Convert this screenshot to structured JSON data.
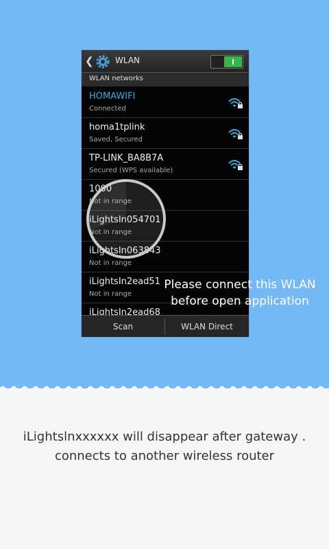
{
  "phone": {
    "title": "WLAN",
    "section_header": "WLAN networks",
    "networks": [
      {
        "name": "HOMAWIFI",
        "status": "Connected",
        "icon": "wifi-secured-icon"
      },
      {
        "name": "homa1tplink",
        "status": "Saved, Secured",
        "icon": "wifi-secured-icon"
      },
      {
        "name": "TP-LINK_BA8B7A",
        "status": "Secured (WPS available)",
        "icon": "wifi-secured-icon"
      },
      {
        "name": "1000",
        "status": "Not in range"
      },
      {
        "name": "iLightsIn054701",
        "status": "Not in range"
      },
      {
        "name": "iLightsIn063843",
        "status": "Not in range"
      },
      {
        "name": "iLightsIn2ead51",
        "status": "Not in range"
      },
      {
        "name": "iLightsIn2ead68",
        "status": ""
      }
    ],
    "bottom_bar": {
      "scan": "Scan",
      "wlan_direct": "WLAN Direct"
    },
    "toggle_state": "on"
  },
  "overlay": {
    "line1": "Please connect this WLAN",
    "line2": "before open application"
  },
  "caption": {
    "line1": "iLightslnxxxxxx  will disappear after gateway .",
    "line2": "connects to another wireless router"
  },
  "colors": {
    "top_background": "#74b9f5",
    "bottom_background": "#f6f6f6",
    "connected_accent": "#3fa7df",
    "toggle_on": "#39b54a"
  }
}
